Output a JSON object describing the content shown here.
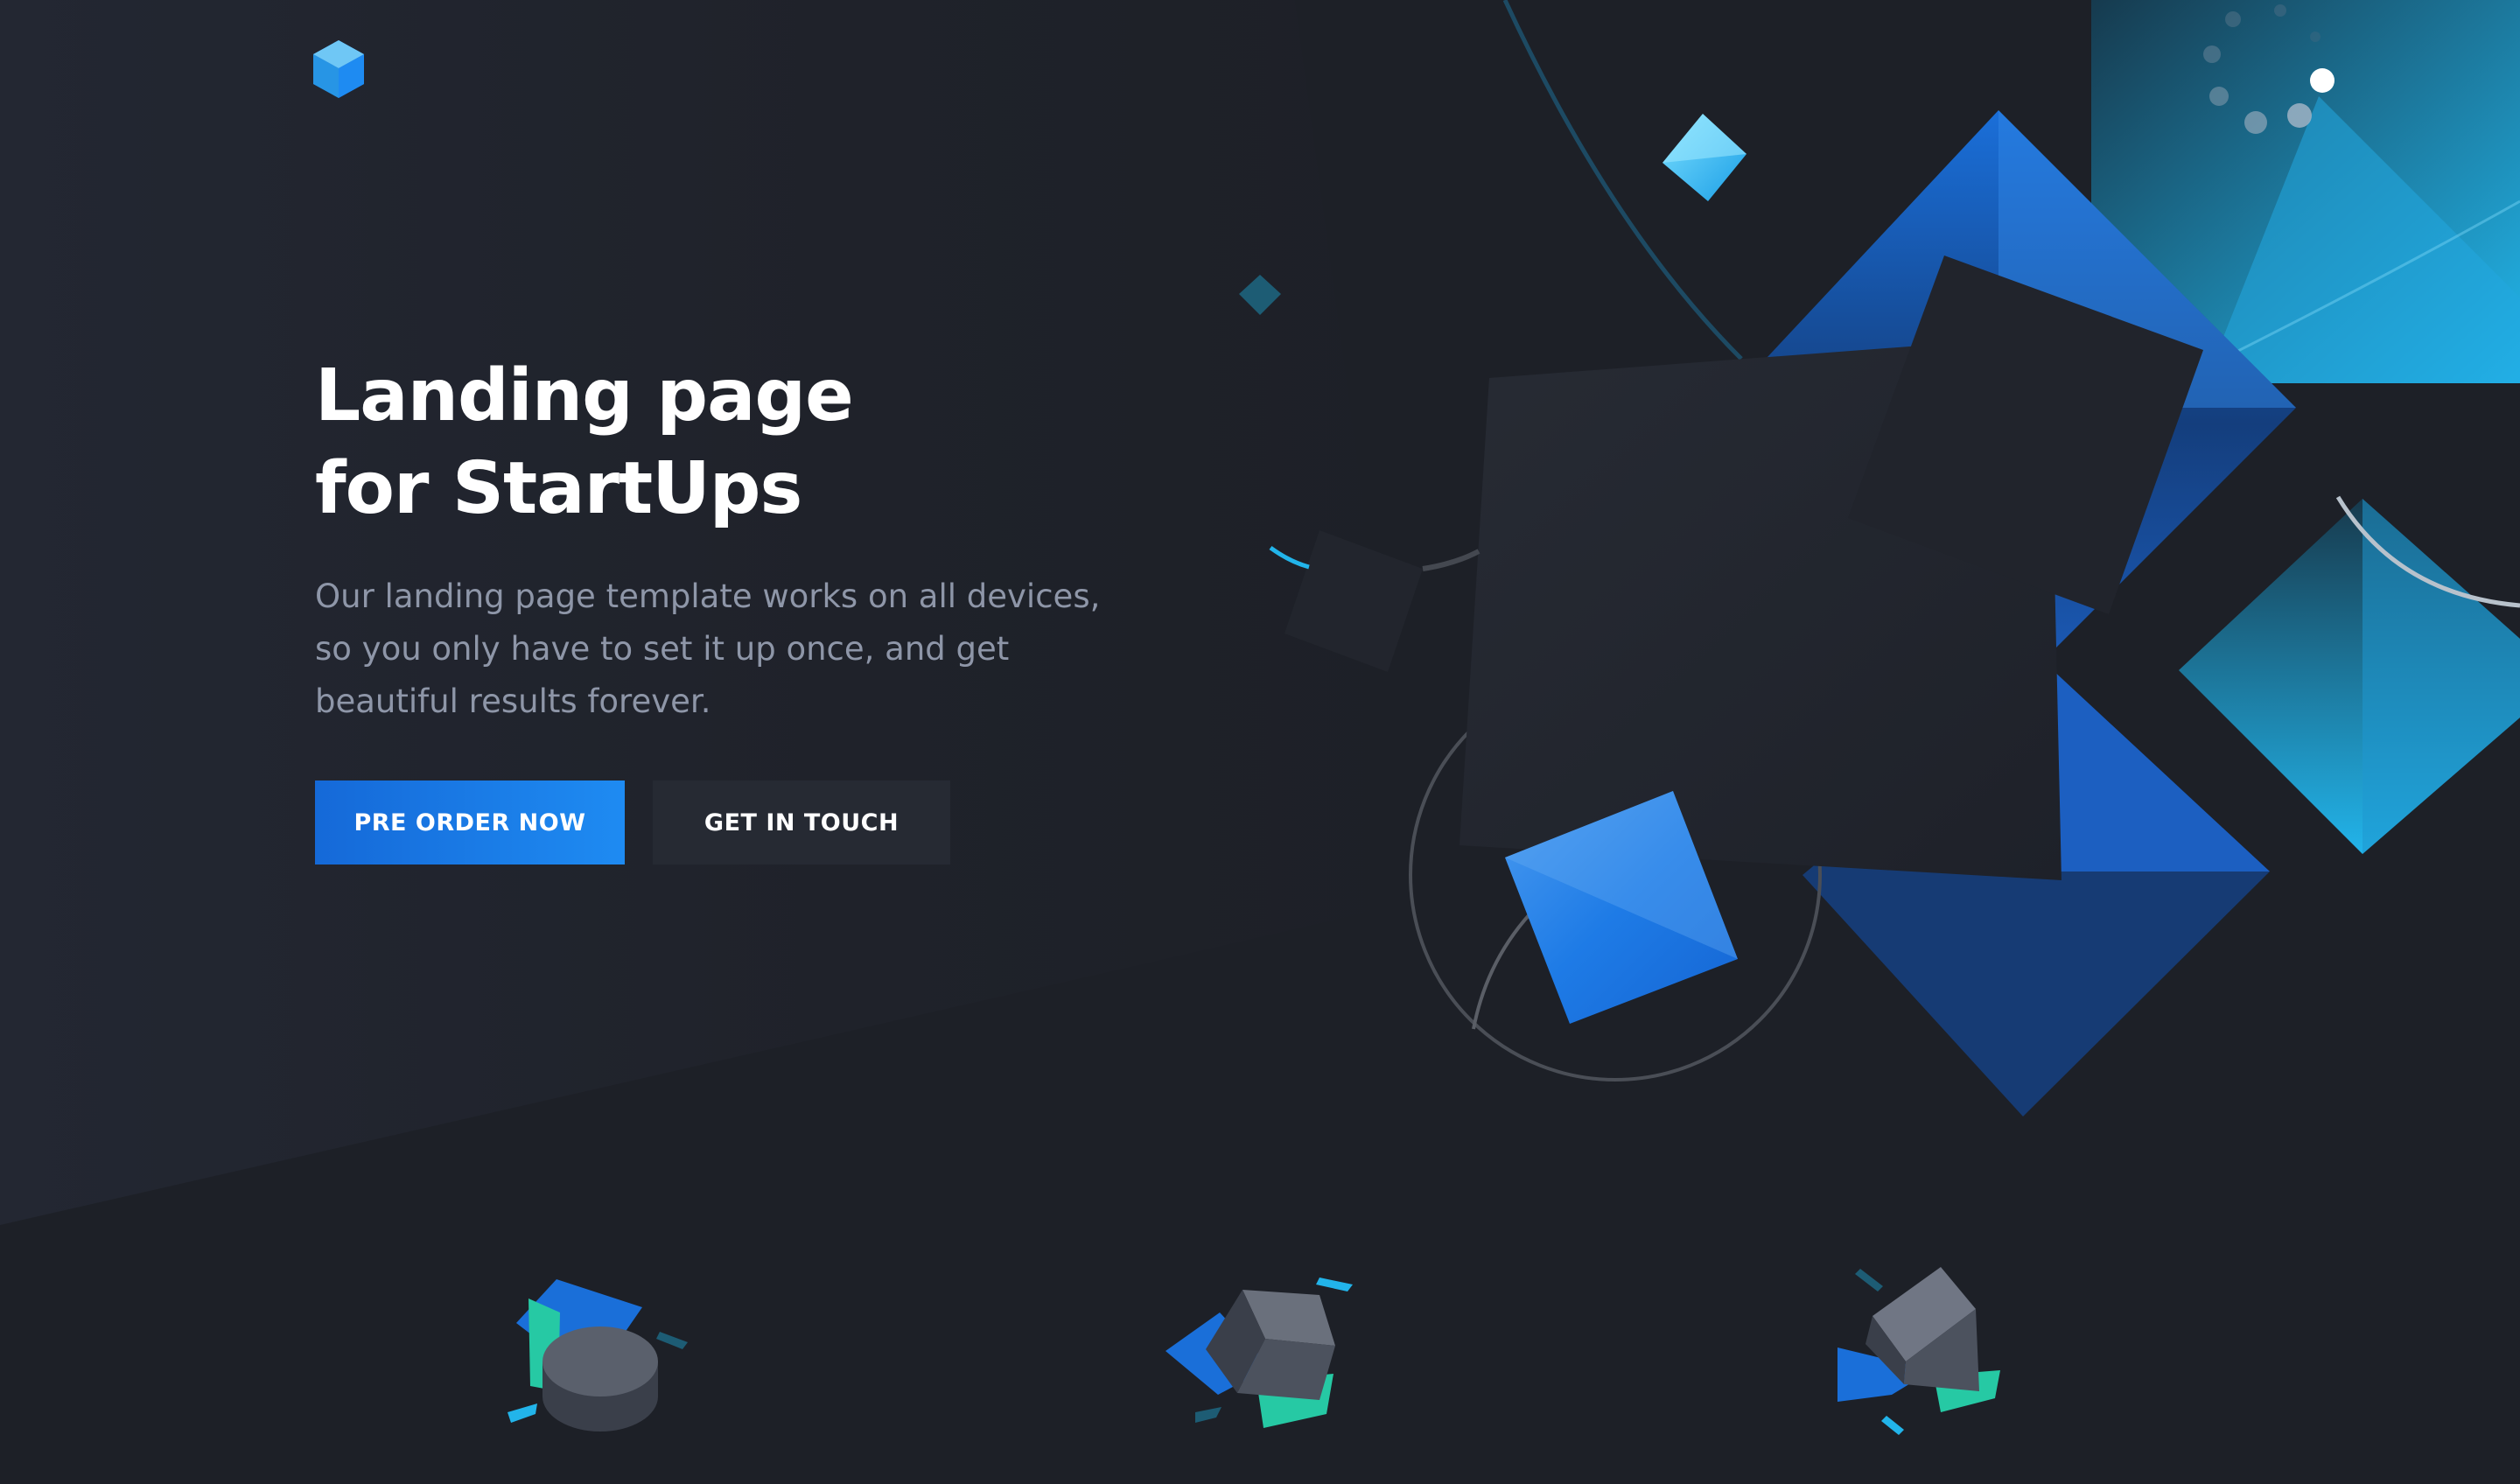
{
  "brand": {
    "logo_icon": "hexagon-cube-logo-icon"
  },
  "hero": {
    "title": "Landing page for StartUps",
    "paragraph": "Our landing page template works on all devices, so you only have to set it up once, and get beautiful results forever.",
    "primary_cta": "PRE ORDER NOW",
    "secondary_cta": "GET IN TOUCH"
  },
  "colors": {
    "background": "#1d2027",
    "accent_blue": "#1e8bf2",
    "accent_cyan": "#20b6ee",
    "accent_teal": "#26c9a4",
    "text_muted": "#8e96a8"
  },
  "feature_icons": [
    "cylinder-shapes-icon",
    "cube-shapes-icon",
    "tilted-cube-shapes-icon"
  ]
}
